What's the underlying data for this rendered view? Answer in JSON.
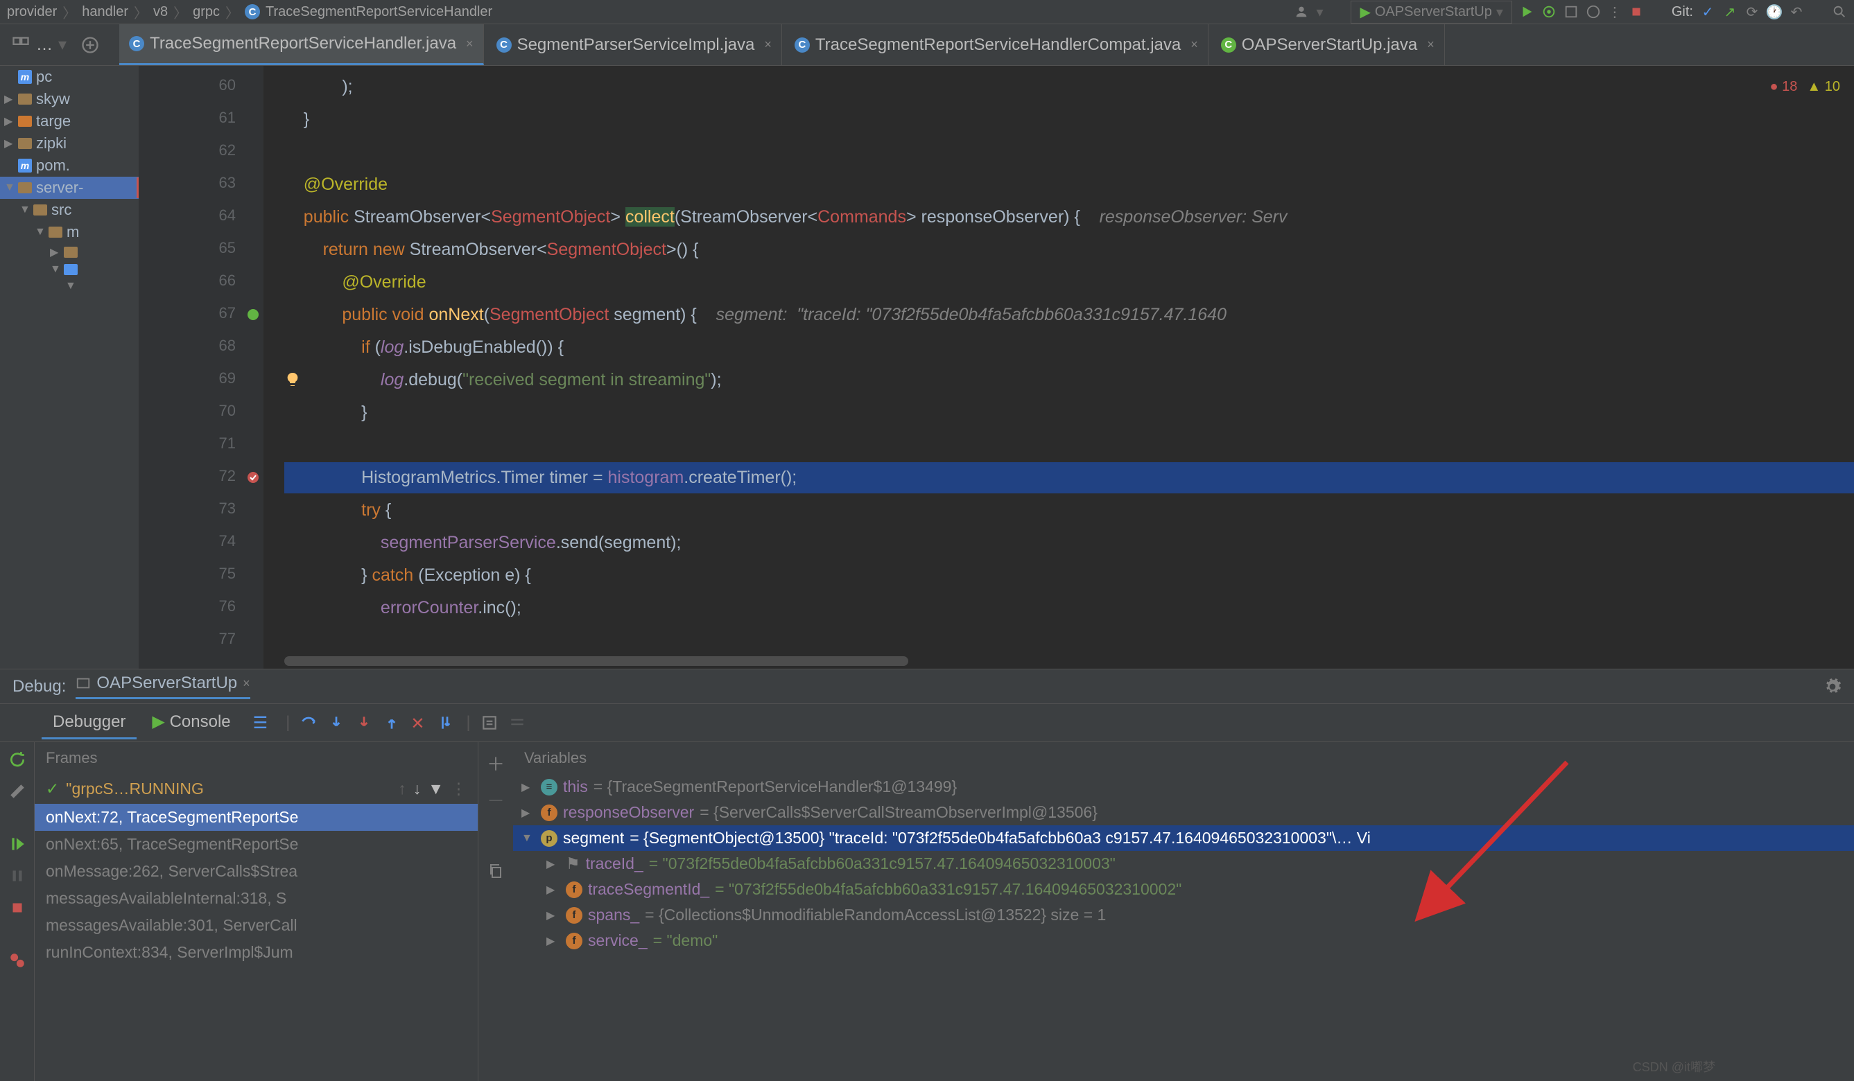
{
  "breadcrumbs": [
    "provider",
    "handler",
    "v8",
    "grpc",
    "TraceSegmentReportServiceHandler"
  ],
  "run_config": "OAPServerStartUp",
  "git_label": "Git:",
  "sidebar": [
    "pc",
    "skyw",
    "targe",
    "zipki",
    "pom.",
    "server-",
    "src",
    "m"
  ],
  "tabs": [
    {
      "label": "TraceSegmentReportServiceHandler.java",
      "active": true
    },
    {
      "label": "SegmentParserServiceImpl.java",
      "active": false
    },
    {
      "label": "TraceSegmentReportServiceHandlerCompat.java",
      "active": false
    },
    {
      "label": "OAPServerStartUp.java",
      "active": false,
      "greenIcon": true
    }
  ],
  "errors": {
    "red": "18",
    "yellow": "10"
  },
  "code": {
    "lines": [
      {
        "n": 60,
        "html": "            );"
      },
      {
        "n": 61,
        "html": "    }"
      },
      {
        "n": 62,
        "html": ""
      },
      {
        "n": 63,
        "html": "    <span class='ann'>@Override</span>"
      },
      {
        "n": 64,
        "html": "    <span class='kw'>public</span> StreamObserver&lt;<span class='red'>SegmentObject</span>&gt; <span class='funcname meth-hl'>collect</span>(StreamObserver&lt;<span class='red'>Commands</span>&gt; responseObserver) {    <span class='comment'>responseObserver: Serv</span>"
      },
      {
        "n": 65,
        "html": "        <span class='kw'>return new</span> StreamObserver&lt;<span class='red'>SegmentObject</span>&gt;() {"
      },
      {
        "n": 66,
        "html": "            <span class='ann'>@Override</span>"
      },
      {
        "n": 67,
        "html": "            <span class='kw'>public void</span> <span class='funcname'>onNext</span>(<span class='red'>SegmentObject</span> segment) {    <span class='comment'>segment:  \"traceId: \"073f2f55de0b4fa5afcbb60a331c9157.47.1640</span>"
      },
      {
        "n": 68,
        "html": "                <span class='kw'>if</span> (<span class='purple'><i>log</i></span>.isDebugEnabled()) {"
      },
      {
        "n": 69,
        "html": "                    <span class='purple'><i>log</i></span>.debug(<span class='str'>\"received segment in streaming\"</span>);"
      },
      {
        "n": 70,
        "html": "                }"
      },
      {
        "n": 71,
        "html": ""
      },
      {
        "n": 72,
        "hl": true,
        "html": "                HistogramMetrics.Timer timer = <span class='pcol'>histogram</span>.createTimer();"
      },
      {
        "n": 73,
        "html": "                <span class='kw'>try</span> {"
      },
      {
        "n": 74,
        "html": "                    <span class='pcol'>segmentParserService</span>.send(segment);"
      },
      {
        "n": 75,
        "html": "                } <span class='kw'>catch</span> (Exception e) {"
      },
      {
        "n": 76,
        "html": "                    <span class='pcol'>errorCounter</span>.inc();"
      },
      {
        "n": 77,
        "html": ""
      }
    ]
  },
  "debug": {
    "title": "Debug:",
    "config": "OAPServerStartUp",
    "tab_debugger": "Debugger",
    "tab_console": "Console",
    "frames_label": "Frames",
    "vars_label": "Variables",
    "thread": "\"grpcS…RUNNING",
    "frames": [
      {
        "label": "onNext:72, TraceSegmentReportSe",
        "sel": true
      },
      {
        "label": "onNext:65, TraceSegmentReportSe"
      },
      {
        "label": "onMessage:262, ServerCalls$Strea"
      },
      {
        "label": "messagesAvailableInternal:318, S"
      },
      {
        "label": "messagesAvailable:301, ServerCall"
      },
      {
        "label": "runInContext:834, ServerImpl$Jum"
      }
    ],
    "variables": [
      {
        "depth": 0,
        "chev": "▶",
        "badge": "teal",
        "badgeText": "≡",
        "name": "this",
        "val": " = {TraceSegmentReportServiceHandler$1@13499}"
      },
      {
        "depth": 0,
        "chev": "▶",
        "badge": "orange",
        "badgeText": "f",
        "name": "responseObserver",
        "val": " = {ServerCalls$ServerCallStreamObserverImpl@13506}"
      },
      {
        "depth": 0,
        "chev": "▼",
        "badge": "yellow",
        "badgeText": "p",
        "name": "segment",
        "sel": true,
        "val": " = {SegmentObject@13500} \"traceId: \"073f2f55de0b4fa5afcbb60a3    c9157.47.16409465032310003\"\\… Vi"
      },
      {
        "depth": 1,
        "chev": "▶",
        "badge": "",
        "flag": true,
        "name": "traceId_",
        "str": " = \"073f2f55de0b4fa5afcbb60a331c9157.47.16409465032310003\""
      },
      {
        "depth": 1,
        "chev": "▶",
        "badge": "orange",
        "badgeText": "f",
        "name": "traceSegmentId_",
        "str": " = \"073f2f55de0b4fa5afcbb60a331c9157.47.16409465032310002\""
      },
      {
        "depth": 1,
        "chev": "▶",
        "badge": "orange",
        "badgeText": "f",
        "name": "spans_",
        "val": " = {Collections$UnmodifiableRandomAccessList@13522}  size = 1"
      },
      {
        "depth": 1,
        "chev": "▶",
        "badge": "orange",
        "badgeText": "f",
        "name": "service_",
        "str": " = \"demo\""
      }
    ]
  },
  "watermark": "CSDN @it嘟梦"
}
